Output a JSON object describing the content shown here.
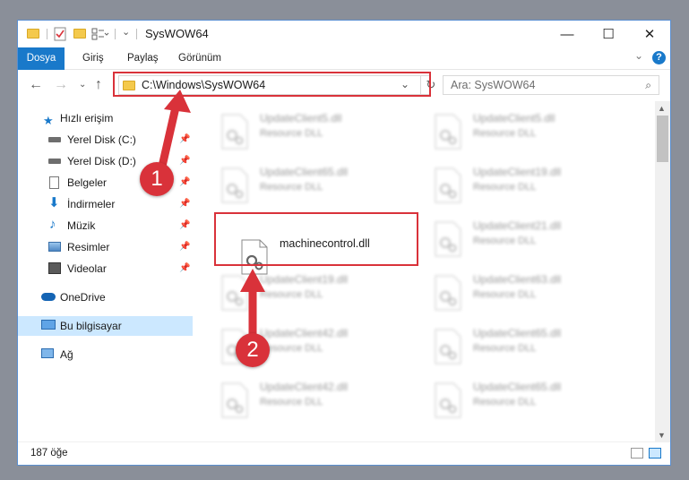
{
  "window": {
    "title": "SysWOW64",
    "minimize": "—",
    "maximize": "☐",
    "close": "✕"
  },
  "ribbon": {
    "tabs": [
      "Dosya",
      "Giriş",
      "Paylaş",
      "Görünüm"
    ]
  },
  "nav": {
    "address": "C:\\Windows\\SysWOW64",
    "search_placeholder": "Ara: SysWOW64"
  },
  "sidebar": {
    "quick_access": "Hızlı erişim",
    "items": [
      "Yerel Disk (C:)",
      "Yerel Disk (D:)",
      "Belgeler",
      "İndirmeler",
      "Müzik",
      "Resimler",
      "Videolar"
    ],
    "onedrive": "OneDrive",
    "this_pc": "Bu bilgisayar",
    "network": "Ağ"
  },
  "files": [
    {
      "name": "UpdateClient5.dll",
      "type": "Resource DLL"
    },
    {
      "name": "UpdateClient5.dll",
      "type": "Resource DLL"
    },
    {
      "name": "UpdateClient65.dll",
      "type": "Resource DLL"
    },
    {
      "name": "UpdateClient19.dll",
      "type": "Resource DLL"
    },
    {
      "name": "machinecontrol.dll",
      "type": ""
    },
    {
      "name": "UpdateClient21.dll",
      "type": "Resource DLL"
    },
    {
      "name": "UpdateClient19.dll",
      "type": "Resource DLL"
    },
    {
      "name": "UpdateClient63.dll",
      "type": "Resource DLL"
    },
    {
      "name": "UpdateClient42.dll",
      "type": "Resource DLL"
    },
    {
      "name": "UpdateClient65.dll",
      "type": "Resource DLL"
    },
    {
      "name": "UpdateClient42.dll",
      "type": "Resource DLL"
    },
    {
      "name": "UpdateClient65.dll",
      "type": "Resource DLL"
    }
  ],
  "status": {
    "count": "187 öğe"
  },
  "annotations": {
    "step1": "1",
    "step2": "2"
  },
  "colors": {
    "accent": "#1979ca",
    "highlight_red": "#d9323a",
    "selected_bg": "#cce8ff"
  }
}
